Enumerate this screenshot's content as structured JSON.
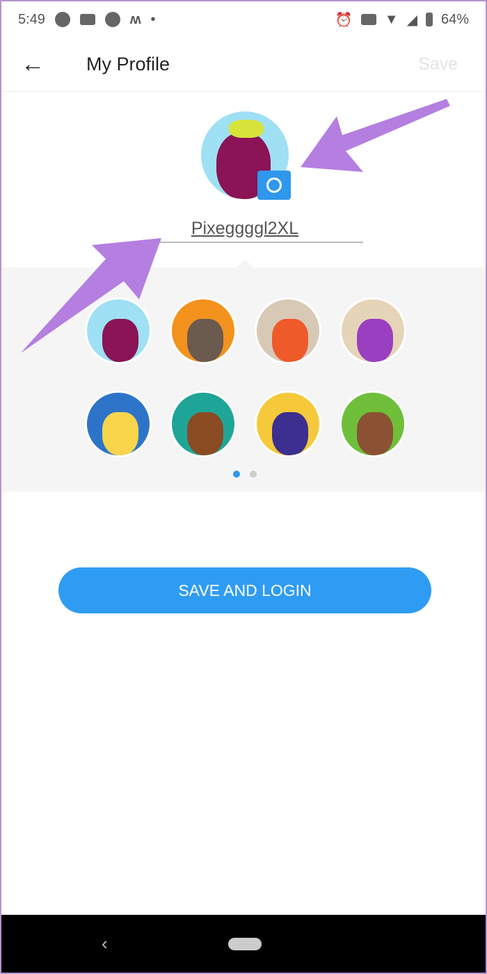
{
  "status_bar": {
    "time": "5:49",
    "battery": "64%",
    "left_icons": [
      "messages-icon",
      "mail-icon",
      "settings-icon",
      "m-app-icon",
      "dot-icon"
    ],
    "right_icons": [
      "alarm-icon",
      "cast-icon",
      "wifi-icon",
      "signal-icon",
      "battery-icon"
    ]
  },
  "app_bar": {
    "title": "My Profile",
    "save_label": "Save"
  },
  "profile": {
    "username": "Pixeggggl2XL",
    "avatar": "eggplant"
  },
  "avatars": [
    {
      "name": "eggplant",
      "bg": "#9fe0f4",
      "fg": "#8a1455"
    },
    {
      "name": "mushroom",
      "bg": "#f3921d",
      "fg": "#6b5a4e"
    },
    {
      "name": "carrot",
      "bg": "#d8c9b7",
      "fg": "#ee5a2a"
    },
    {
      "name": "grapes",
      "bg": "#e6d4b8",
      "fg": "#9a3fc0"
    },
    {
      "name": "blonde-girl",
      "bg": "#2d74c9",
      "fg": "#f8d54a"
    },
    {
      "name": "brown-hair-man",
      "bg": "#1fa597",
      "fg": "#8a4b22"
    },
    {
      "name": "purple-hair-woman",
      "bg": "#f5c93a",
      "fg": "#3b2f8f"
    },
    {
      "name": "mustache-man",
      "bg": "#6fbf3a",
      "fg": "#8a5232"
    }
  ],
  "pager": {
    "pages": 2,
    "current": 1
  },
  "primary_button": "SAVE AND LOGIN",
  "colors": {
    "accent": "#2f9cf3",
    "annotation_arrow": "#b47fe0"
  }
}
